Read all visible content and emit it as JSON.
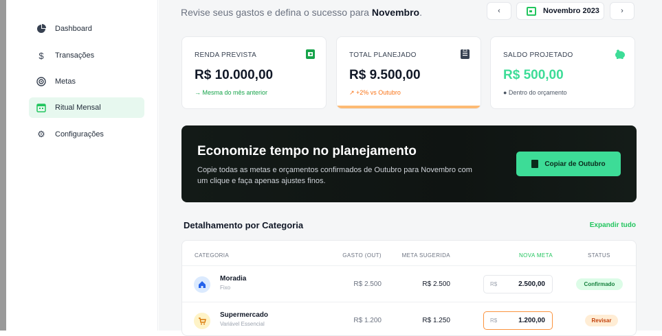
{
  "sidebar": {
    "items": [
      {
        "label": "Dashboard",
        "icon": "pie-chart-icon"
      },
      {
        "label": "Transações",
        "icon": "dollar-icon"
      },
      {
        "label": "Metas",
        "icon": "target-icon"
      },
      {
        "label": "Ritual Mensal",
        "icon": "calendar-icon",
        "active": true
      },
      {
        "label": "Configurações",
        "icon": "gear-icon"
      }
    ]
  },
  "header": {
    "subtitle_prefix": "Revise seus gastos e defina o sucesso para ",
    "subtitle_month": "Novembro",
    "subtitle_suffix": ".",
    "prev": "‹",
    "next": "›",
    "month": "Novembro 2023"
  },
  "cards": [
    {
      "label": "RENDA PREVISTA",
      "value": "R$ 10.000,00",
      "note": "→ Mesma do mês anterior",
      "note_color": "#16a34a",
      "icon": "wallet-icon"
    },
    {
      "label": "TOTAL PLANEJADO",
      "value": "R$ 9.500,00",
      "note": "↗ +2% vs Outubro",
      "note_color": "#f97316",
      "icon": "clipboard-icon"
    },
    {
      "label": "SALDO PROJETADO",
      "value": "R$ 500,00",
      "note": "● Dentro do orçamento",
      "note_color": "#4b5563",
      "icon": "piggy-bank-icon"
    }
  ],
  "banner": {
    "title": "Economize tempo no planejamento",
    "description": "Copie todas as metas e orçamentos confirmados de Outubro para Novembro com um clique e faça apenas ajustes finos.",
    "button": "Copiar de Outubro"
  },
  "section": {
    "title": "Detalhamento por Categoria",
    "expand": "Expandir tudo"
  },
  "table": {
    "headers": [
      "CATEGORIA",
      "GASTO (OUT)",
      "META SUGERIDA",
      "NOVA META",
      "STATUS"
    ],
    "rows": [
      {
        "name": "Moradia",
        "type": "Fixo",
        "spent": "R$ 2.500",
        "suggested": "R$ 2.500",
        "currency": "R$",
        "new_goal": "2.500,00",
        "status": "Confirmado",
        "icon": "home-icon"
      },
      {
        "name": "Supermercado",
        "type": "Variável Essencial",
        "spent": "R$ 1.200",
        "suggested": "R$ 1.250",
        "currency": "R$",
        "new_goal": "1.200,00",
        "status": "Revisar",
        "icon": "cart-icon"
      }
    ]
  },
  "colors": {
    "accent": "#22c55e",
    "cta": "#3ddc97",
    "warning": "#f97316",
    "banner_bg": "#131a17"
  }
}
